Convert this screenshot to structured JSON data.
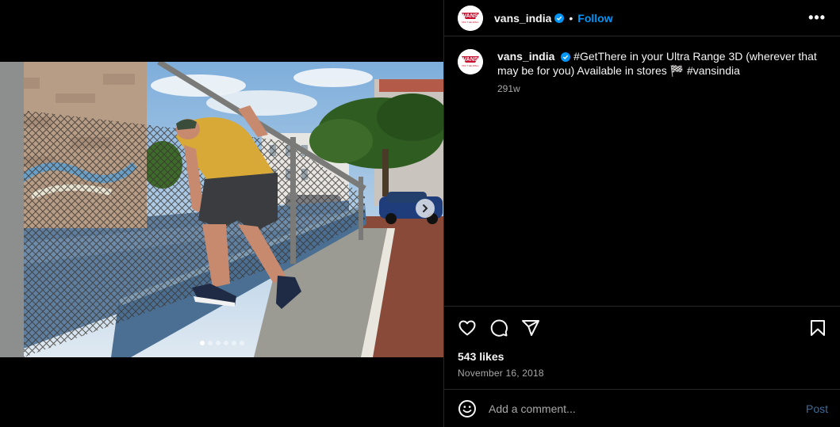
{
  "post": {
    "username": "vans_india",
    "follow_label": "Follow",
    "separator": "•",
    "more_label": "•••",
    "caption_text": "#GetThere in your Ultra Range 3D (wherever that may be for you) Available in stores 🏁 #vansindia",
    "caption_age": "291w",
    "likes": "543 likes",
    "date": "November 16, 2018",
    "comment_placeholder": "Add a comment...",
    "post_label": "Post",
    "carousel": {
      "total": 6,
      "current": 1
    }
  },
  "brand": {
    "logo_text": "VANS",
    "logo_subtext": "OFF THE WALL"
  },
  "colors": {
    "accent": "#0095f6",
    "verified": "#0095f6",
    "background": "#000000",
    "muted": "#a8a8a8"
  },
  "icons": [
    "verified-icon",
    "more-icon",
    "heart-icon",
    "comment-icon",
    "share-icon",
    "bookmark-icon",
    "emoji-icon",
    "chevron-right-icon"
  ]
}
